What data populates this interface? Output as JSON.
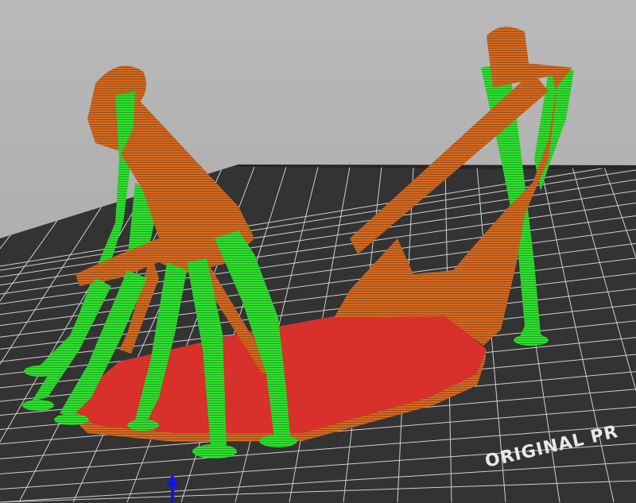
{
  "viewport": {
    "bed_label": "ORIGINAL PR",
    "colors": {
      "background": "#aaaaaa",
      "bed": "#323232",
      "grid": "#d0d0d0",
      "model": "#d2691e",
      "raft": "#d8302a",
      "support": "#2ee02e",
      "axis_z": "#1010ff"
    }
  }
}
